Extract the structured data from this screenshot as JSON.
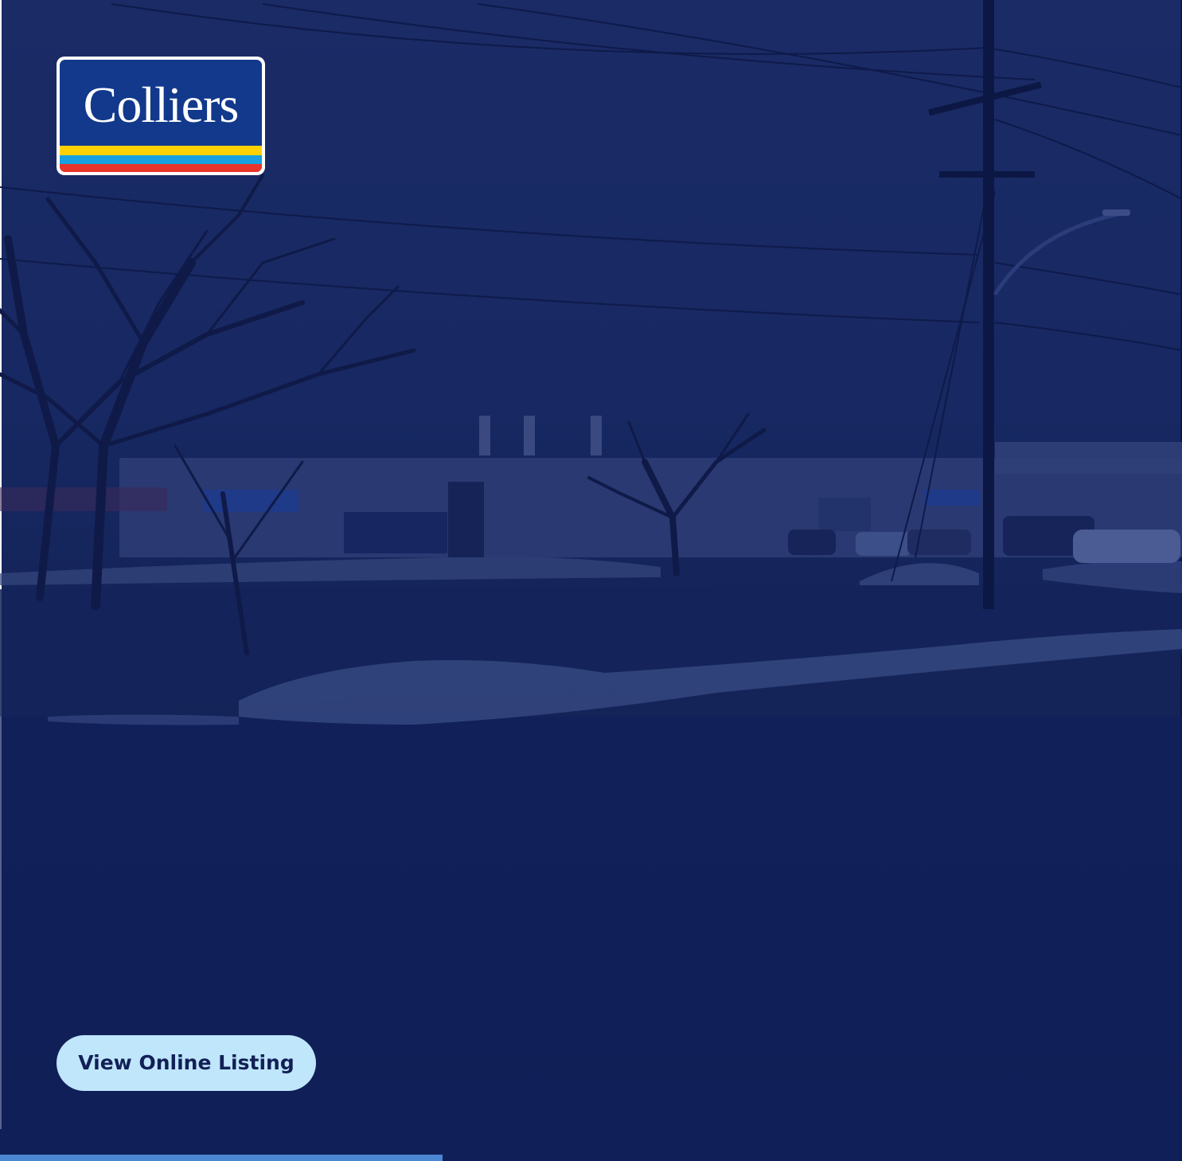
{
  "brand": {
    "logo_text": "Colliers",
    "colors": {
      "logo_blue": "#12398b",
      "logo_yellow": "#ffd100",
      "logo_cyan": "#19a0e0",
      "logo_red": "#e9342a",
      "overlay_navy": "#142459",
      "button_bg": "#bfe6fb",
      "button_text": "#122056",
      "accent_bar": "#4a86d2"
    }
  },
  "hero": {
    "image_description_icon": "street-photo-industrial-building"
  },
  "cta": {
    "label": "View Online Listing"
  }
}
